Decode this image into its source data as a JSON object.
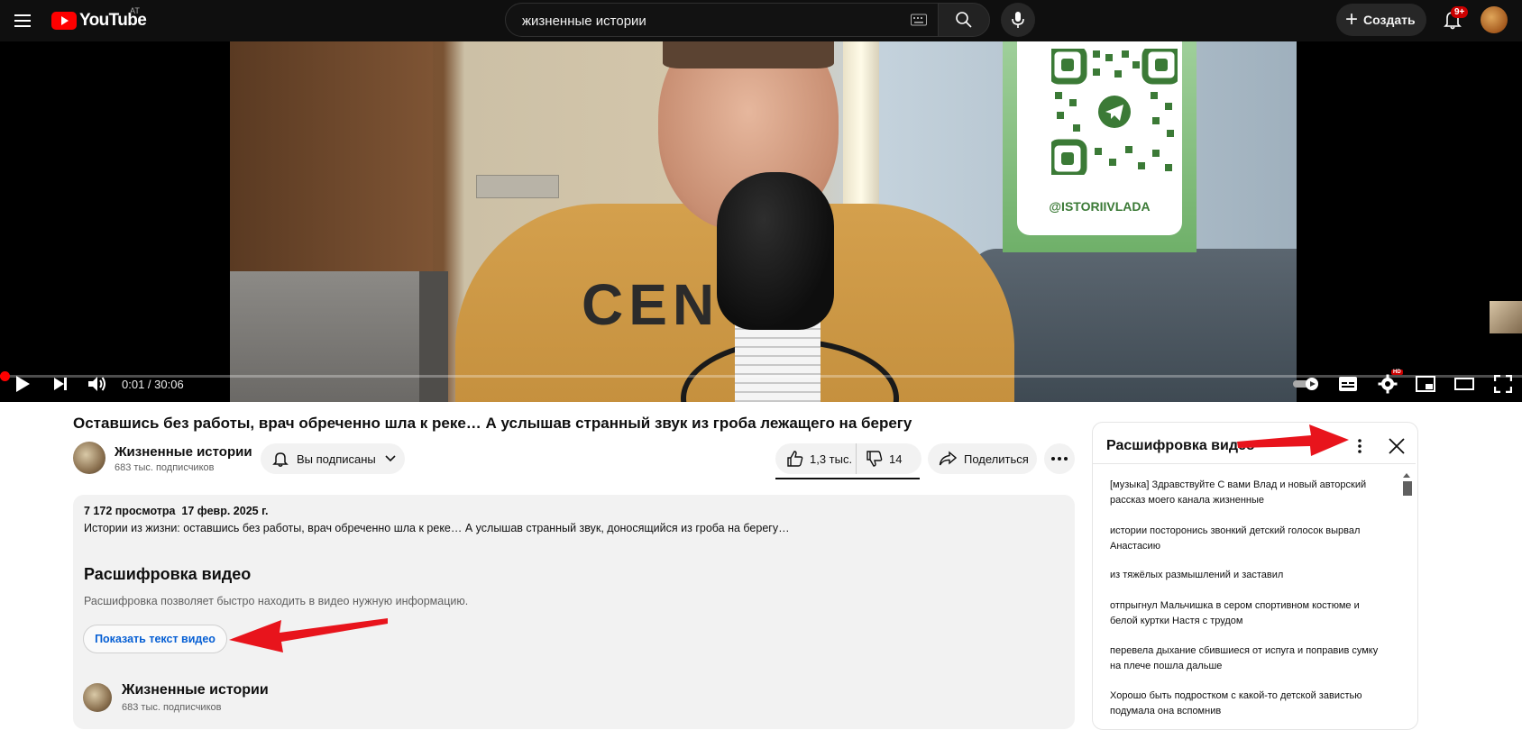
{
  "header": {
    "logo_text": "YouTube",
    "country_code": "AT",
    "search_value": "жизненные истории",
    "create_label": "Создать",
    "notifications_badge": "9+"
  },
  "player": {
    "time": "0:01 / 30:06",
    "progress_fraction": 0.0006,
    "overlay_handle": "@ISTORIIVLADA",
    "shirt_text": "CENT",
    "hd_badge": "HD"
  },
  "video": {
    "title": "Оставшись без работы, врач обреченно шла к реке… А услышав странный звук из гроба лежащего на берегу",
    "channel_name": "Жизненные истории",
    "channel_subs": "683 тыс. подписчиков",
    "subscribed_label": "Вы подписаны",
    "likes": "1,3 тыс.",
    "dislikes": "14",
    "share_label": "Поделиться"
  },
  "description": {
    "stats": "7 172 просмотра  17 февр. 2025 г.",
    "text": "Истории из жизни: оставшись без работы, врач обреченно шла к реке… А услышав странный звук, доносящийся из гроба на берегу…",
    "transcript_heading": "Расшифровка видео",
    "transcript_subtext": "Расшифровка позволяет быстро находить в видео нужную информацию.",
    "show_transcript_label": "Показать текст видео",
    "channel_name": "Жизненные истории",
    "channel_subs": "683 тыс. подписчиков"
  },
  "transcript_panel": {
    "title": "Расшифровка видео",
    "lines": [
      "[музыка] Здравствуйте С вами Влад и новый авторский рассказ моего канала жизненные",
      "истории посторонись звонкий детский голосок вырвал Анастасию",
      "из тяжёлых размышлений и заставил",
      "отпрыгнул Мальчишка в сером спортивном костюме и белой куртки Настя с трудом",
      "перевела дыхание сбившиеся от испуга и поправив сумку на плече пошла дальше",
      "Хорошо быть подростком с какой-то детской завистью подумала она вспомнив"
    ]
  },
  "colors": {
    "accent_red": "#ff0000",
    "link_blue": "#065fd4",
    "topbar_bg": "#0f0f0f",
    "annotation_arrow": "#e8141c"
  },
  "icons": [
    "menu-icon",
    "youtube-logo-icon",
    "keyboard-icon",
    "search-icon",
    "mic-icon",
    "plus-icon",
    "bell-icon",
    "play-icon",
    "next-icon",
    "volume-icon",
    "autoplay-toggle-icon",
    "subtitles-icon",
    "settings-icon",
    "miniplayer-icon",
    "theater-icon",
    "fullscreen-icon",
    "bell-ring-icon",
    "chevron-down-icon",
    "thumbs-up-icon",
    "thumbs-down-icon",
    "share-icon",
    "more-horiz-icon",
    "more-vert-icon",
    "close-icon"
  ]
}
